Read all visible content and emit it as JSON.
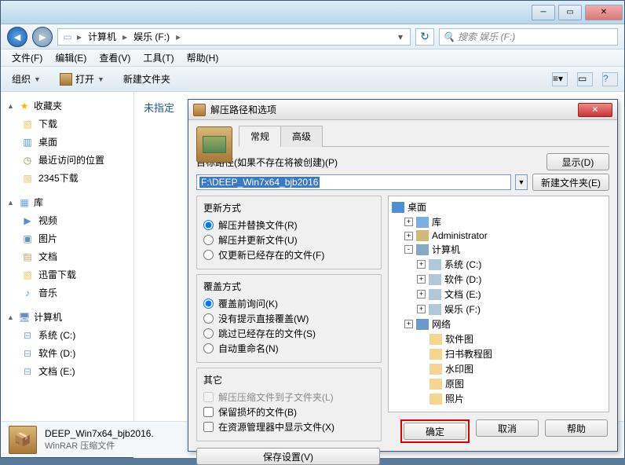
{
  "explorer": {
    "breadcrumb": {
      "computer": "计算机",
      "drive": "娱乐 (F:)"
    },
    "search_placeholder": "搜索 娱乐 (F:)",
    "menus": {
      "file": "文件(F)",
      "edit": "编辑(E)",
      "view": "查看(V)",
      "tools": "工具(T)",
      "help": "帮助(H)"
    },
    "toolbar": {
      "organize": "组织",
      "open": "打开",
      "new_folder": "新建文件夹"
    },
    "sidebar": {
      "favorites": {
        "label": "收藏夹",
        "items": [
          "下载",
          "桌面",
          "最近访问的位置",
          "2345下载"
        ]
      },
      "libraries": {
        "label": "库",
        "items": [
          "视频",
          "图片",
          "文档",
          "迅雷下载",
          "音乐"
        ]
      },
      "computer": {
        "label": "计算机",
        "items": [
          "系统 (C:)",
          "软件 (D:)",
          "文档 (E:)"
        ]
      }
    },
    "main_header": "未指定",
    "status": {
      "filename": "DEEP_Win7x64_bjb2016.",
      "type": "WinRAR 压缩文件"
    }
  },
  "dialog": {
    "title": "解压路径和选项",
    "tabs": {
      "general": "常规",
      "advanced": "高级"
    },
    "path_label": "目标路径(如果不存在将被创建)(P)",
    "path_value": "F:\\DEEP_Win7x64_bjb2016",
    "show_btn": "显示(D)",
    "new_folder_btn": "新建文件夹(E)",
    "update": {
      "title": "更新方式",
      "opts": [
        "解压并替换文件(R)",
        "解压并更新文件(U)",
        "仅更新已经存在的文件(F)"
      ]
    },
    "overwrite": {
      "title": "覆盖方式",
      "opts": [
        "覆盖前询问(K)",
        "没有提示直接覆盖(W)",
        "跳过已经存在的文件(S)",
        "自动重命名(N)"
      ]
    },
    "misc": {
      "title": "其它",
      "opts": [
        "解压压缩文件到子文件夹(L)",
        "保留损坏的文件(B)",
        "在资源管理器中显示文件(X)"
      ]
    },
    "save_settings": "保存设置(V)",
    "tree": {
      "desktop": "桌面",
      "lib": "库",
      "admin": "Administrator",
      "computer": "计算机",
      "drives": [
        "系统 (C:)",
        "软件 (D:)",
        "文档 (E:)",
        "娱乐 (F:)"
      ],
      "network": "网络",
      "folders": [
        "软件图",
        "扫书教程图",
        "水印图",
        "原图",
        "照片"
      ]
    },
    "buttons": {
      "ok": "确定",
      "cancel": "取消",
      "help": "帮助"
    }
  }
}
